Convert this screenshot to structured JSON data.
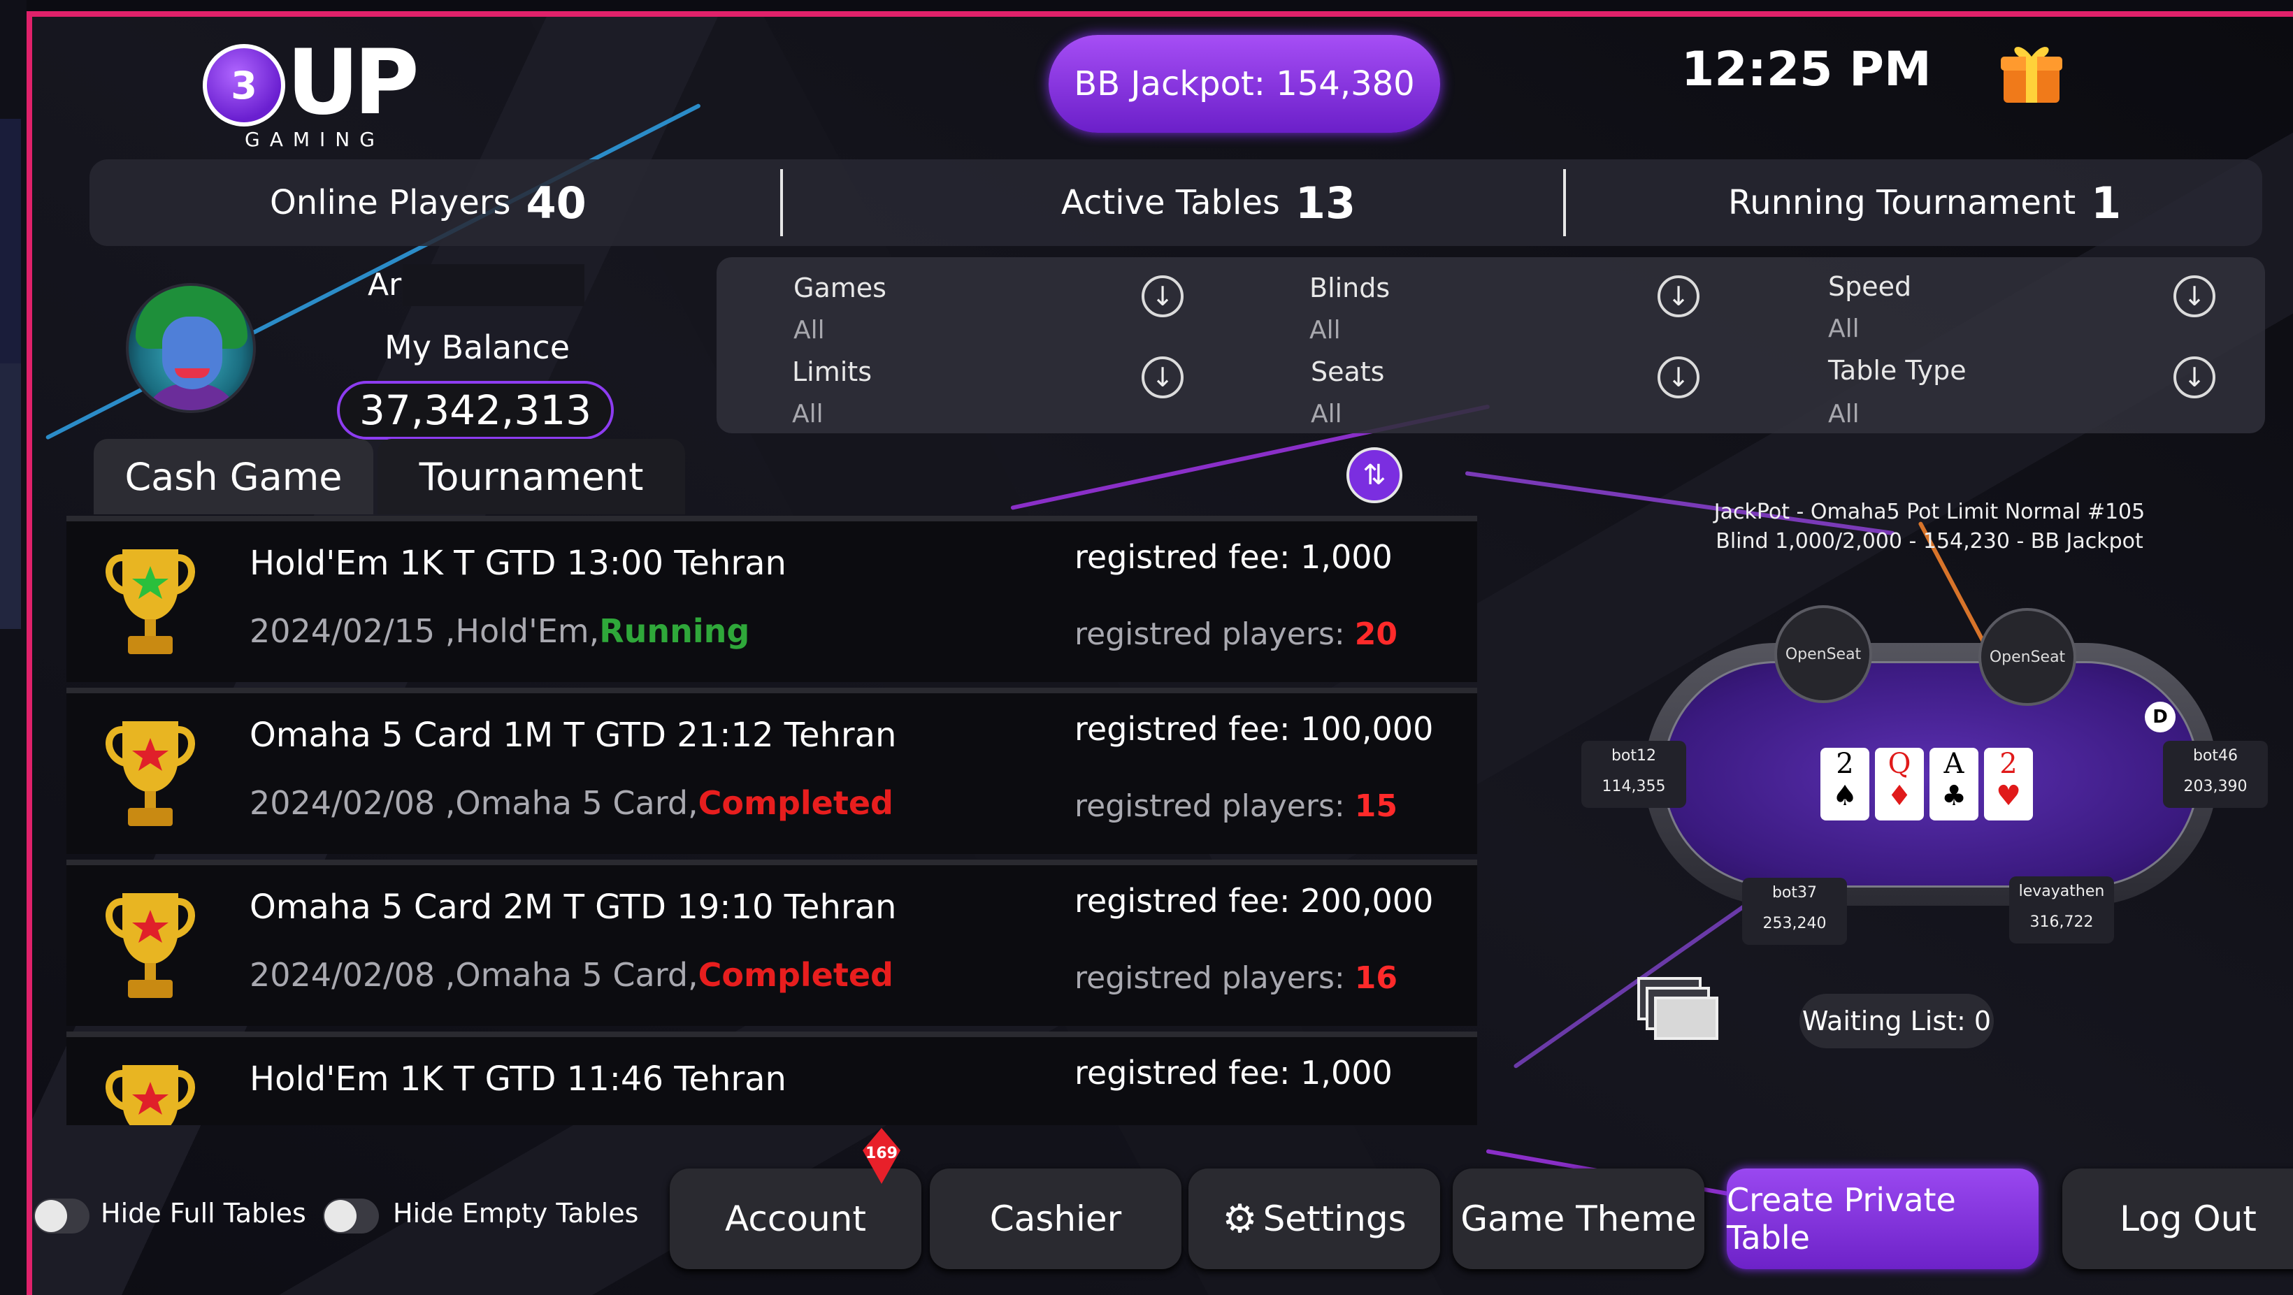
{
  "brand": {
    "logo_number": "3",
    "logo_text": "UP",
    "logo_sub": "GAMING"
  },
  "header": {
    "jackpot": "BB Jackpot: 154,380",
    "clock": "12:25 PM"
  },
  "stats": [
    {
      "label": "Online Players",
      "value": "40"
    },
    {
      "label": "Active Tables",
      "value": "13"
    },
    {
      "label": "Running Tournament",
      "value": "1"
    }
  ],
  "profile": {
    "username": "Ar",
    "balance_label": "My Balance",
    "balance": "37,342,313"
  },
  "filters": [
    {
      "label": "Games",
      "value": "All"
    },
    {
      "label": "Blinds",
      "value": "All"
    },
    {
      "label": "Speed",
      "value": "All"
    },
    {
      "label": "Limits",
      "value": "All"
    },
    {
      "label": "Seats",
      "value": "All"
    },
    {
      "label": "Table Type",
      "value": "All"
    }
  ],
  "tabs": {
    "cash": "Cash Game",
    "tournament": "Tournament"
  },
  "tournaments": [
    {
      "title": "Hold'Em 1K T  GTD 13:00 Tehran",
      "date": "2024/02/15 ,Hold'Em,",
      "status": "Running",
      "status_color": "#2fa83a",
      "fee": "registred fee: 1,000",
      "players_label": "registred players:",
      "players": "20",
      "star_color": "#2bbf3c"
    },
    {
      "title": "Omaha 5 Card 1M T  GTD 21:12 Tehran",
      "date": "2024/02/08 ,Omaha 5 Card,",
      "status": "Completed",
      "status_color": "#e81e1e",
      "fee": "registred fee: 100,000",
      "players_label": "registred players:",
      "players": "15",
      "star_color": "#e0202a"
    },
    {
      "title": "Omaha 5 Card 2M T  GTD 19:10 Tehran",
      "date": "2024/02/08 ,Omaha 5 Card,",
      "status": "Completed",
      "status_color": "#e81e1e",
      "fee": "registred fee: 200,000",
      "players_label": "registred players:",
      "players": "16",
      "star_color": "#e0202a"
    },
    {
      "title": "Hold'Em 1K T  GTD 11:46 Tehran",
      "date": "",
      "status": "",
      "status_color": "#e81e1e",
      "fee": "registred fee: 1,000",
      "players_label": "",
      "players": "",
      "star_color": "#e0202a"
    }
  ],
  "preview": {
    "line1": "JackPot  - Omaha5 Pot Limit Normal #105",
    "line2": "Blind 1,000/2,000 - 154,230 - BB Jackpot",
    "open_seat": "OpenSeat",
    "players": [
      {
        "name": "bot12",
        "chips": "114,355"
      },
      {
        "name": "bot46",
        "chips": "203,390"
      },
      {
        "name": "bot37",
        "chips": "253,240"
      },
      {
        "name": "levayathen",
        "chips": "316,722"
      }
    ],
    "cards": [
      {
        "rank": "2",
        "suit": "♠"
      },
      {
        "rank": "Q",
        "suit": "♦"
      },
      {
        "rank": "A",
        "suit": "♣"
      },
      {
        "rank": "2",
        "suit": "♥"
      }
    ],
    "dealer": "D",
    "waiting": "Waiting List: 0"
  },
  "bottom": {
    "hide_full": "Hide Full Tables",
    "hide_empty": "Hide Empty Tables",
    "account": "Account",
    "account_badge": "169",
    "cashier": "Cashier",
    "settings": "Settings",
    "theme": "Game Theme",
    "create": "Create Private Table",
    "logout": "Log Out"
  },
  "colors": {
    "accent": "#8d3cf0",
    "frame": "#e0216a"
  }
}
